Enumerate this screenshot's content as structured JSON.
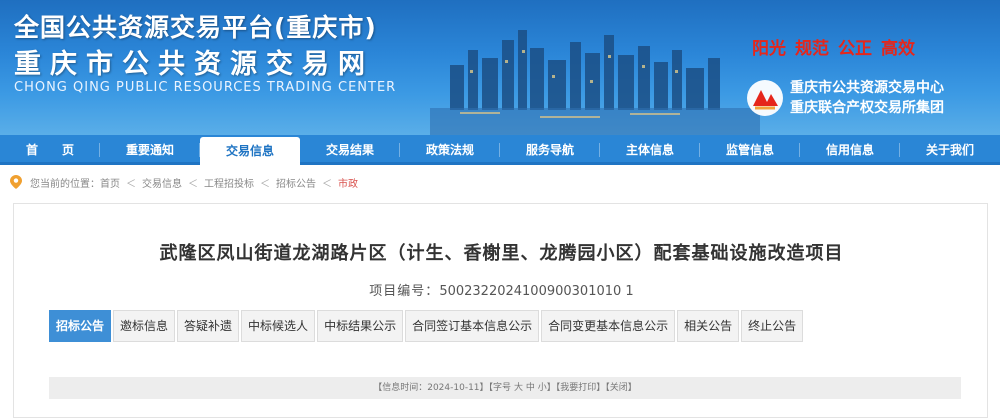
{
  "header": {
    "title_main": "全国公共资源交易平台(重庆市)",
    "title_sub": "重庆市公共资源交易网",
    "title_en": "CHONG QING PUBLIC RESOURCES TRADING CENTER",
    "slogan": [
      "阳光",
      "规范",
      "公正",
      "高效"
    ],
    "org_lines": [
      "重庆市公共资源交易中心",
      "重庆联合产权交易所集团"
    ]
  },
  "nav": {
    "items": [
      {
        "label": "首　　页"
      },
      {
        "label": "重要通知"
      },
      {
        "label": "交易信息"
      },
      {
        "label": "交易结果"
      },
      {
        "label": "政策法规"
      },
      {
        "label": "服务导航"
      },
      {
        "label": "主体信息"
      },
      {
        "label": "监管信息"
      },
      {
        "label": "信用信息"
      },
      {
        "label": "关于我们"
      }
    ],
    "active_index": 2
  },
  "breadcrumb": {
    "prefix": "您当前的位置：",
    "items": [
      "首页",
      "交易信息",
      "工程招投标",
      "招标公告"
    ],
    "current": "市政",
    "separator": "＜"
  },
  "project": {
    "title": "武隆区凤山街道龙湖路片区（计生、香榭里、龙腾园小区）配套基础设施改造项目",
    "number_label": "项目编号：",
    "number_value": "5002322024100900301010 1"
  },
  "tabs": {
    "items": [
      "招标公告",
      "邀标信息",
      "答疑补遗",
      "中标候选人",
      "中标结果公示",
      "合同签订基本信息公示",
      "合同变更基本信息公示",
      "相关公告",
      "终止公告"
    ],
    "active_index": 0
  },
  "infobar": {
    "time_label": "【信息时间：",
    "time_value": "2024-10-11",
    "font_label": "】【字号",
    "font_large": "大",
    "font_medium": "中",
    "font_small": "小",
    "print": "】【我要打印】",
    "close": "【关闭】"
  },
  "colors": {
    "nav_bg": "#2a86d6",
    "tab_active": "#3e8fd6",
    "slogan": "#e5261b",
    "breadcrumb_current": "#d9534f"
  }
}
